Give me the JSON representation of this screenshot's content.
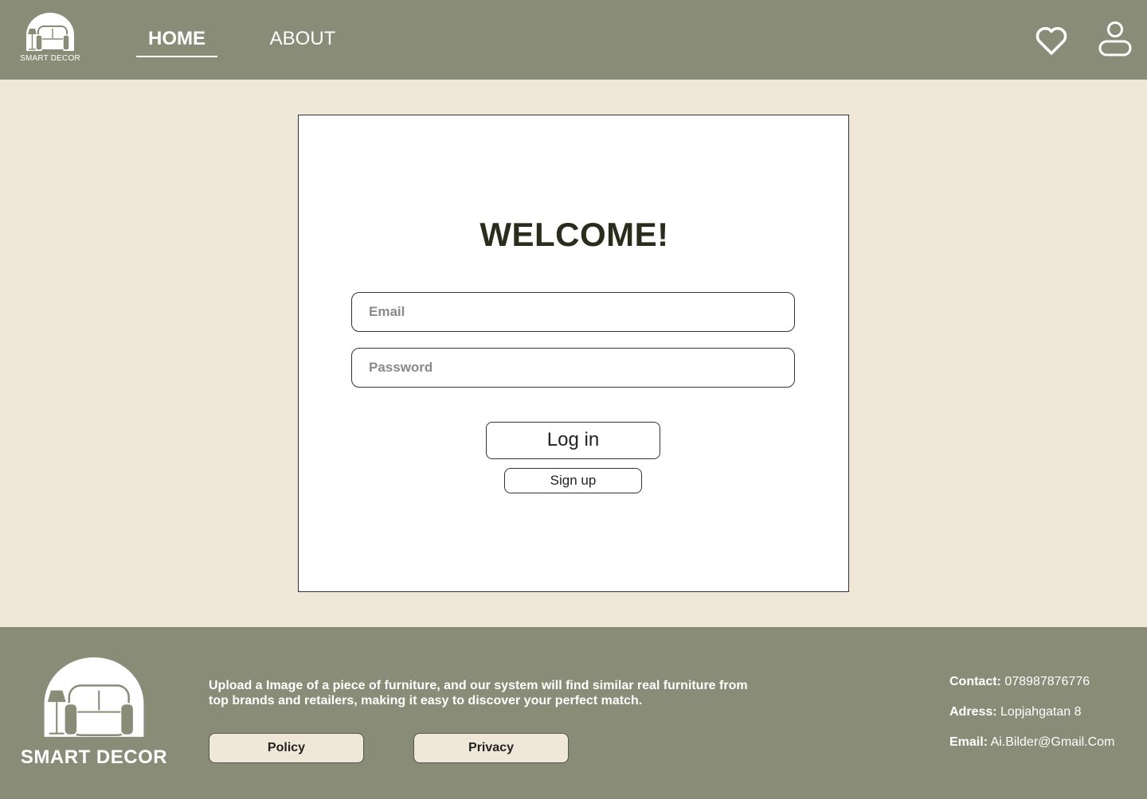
{
  "header": {
    "logo_text": "SMART DECOR",
    "nav": {
      "home": "HOME",
      "about": "ABOUT"
    },
    "icons": [
      "heart-icon",
      "user-icon"
    ]
  },
  "login": {
    "title": "WELCOME!",
    "email_placeholder": "Email",
    "password_placeholder": "Password",
    "login_label": "Log in",
    "signup_label": "Sign up"
  },
  "footer": {
    "logo_text": "SMART DECOR",
    "description": "Upload a Image of a piece of furniture, and our system will find similar real furniture from top brands and retailers, making it easy to discover your perfect match.",
    "policy_label": "Policy",
    "privacy_label": "Privacy",
    "contact": {
      "contact_label": "Contact:",
      "contact_value": "078987876776",
      "address_label": "Adress:",
      "address_value": "Lopjahgatan 8",
      "email_label": "Email:",
      "email_value": "Ai.Bilder@Gmail.Com"
    }
  },
  "colors": {
    "header_bg": "#898d77",
    "page_bg": "#efe8d8",
    "title_text": "#2b2d1c"
  }
}
